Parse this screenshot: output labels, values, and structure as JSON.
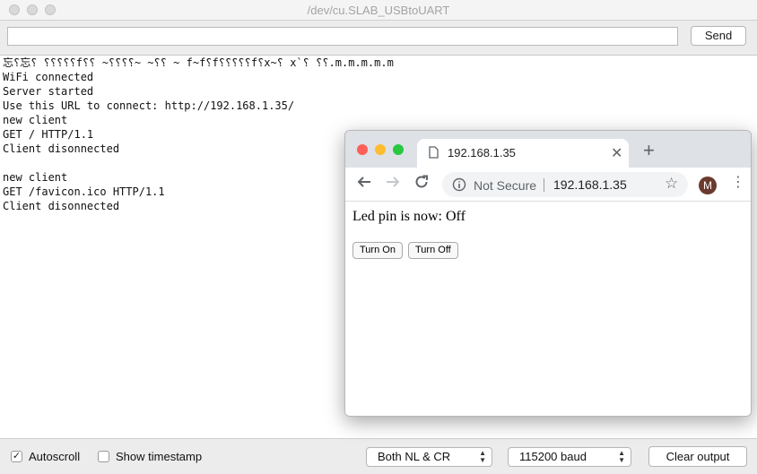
{
  "serial": {
    "title": "/dev/cu.SLAB_USBtoUART",
    "send_label": "Send",
    "input_value": "",
    "output_lines": [
      "忘⸮忘⸮ ⸮⸮⸮⸮⸮f⸮⸮ ~⸮⸮⸮⸮~ ~⸮⸮ ~ f~f⸮f⸮⸮⸮⸮⸮f⸮x~⸮ x`⸮ ⸮⸮.m.m.m.m.m",
      "WiFi connected",
      "Server started",
      "Use this URL to connect: http://192.168.1.35/",
      "new client",
      "GET / HTTP/1.1",
      "Client disonnected",
      "",
      "new client",
      "GET /favicon.ico HTTP/1.1",
      "Client disonnected"
    ],
    "autoscroll_label": "Autoscroll",
    "autoscroll_checked": "✓",
    "timestamp_label": "Show timestamp",
    "line_ending": "Both NL & CR",
    "baud": "115200 baud",
    "clear_label": "Clear output"
  },
  "browser": {
    "tab_title": "192.168.1.35",
    "not_secure": "Not Secure",
    "url": "192.168.1.35",
    "avatar_initial": "M",
    "page_text": "Led pin is now: Off",
    "btn_on": "Turn On",
    "btn_off": "Turn Off",
    "traffic": {
      "red": "#fe5f57",
      "yellow": "#febc2e",
      "green": "#28c840"
    }
  }
}
